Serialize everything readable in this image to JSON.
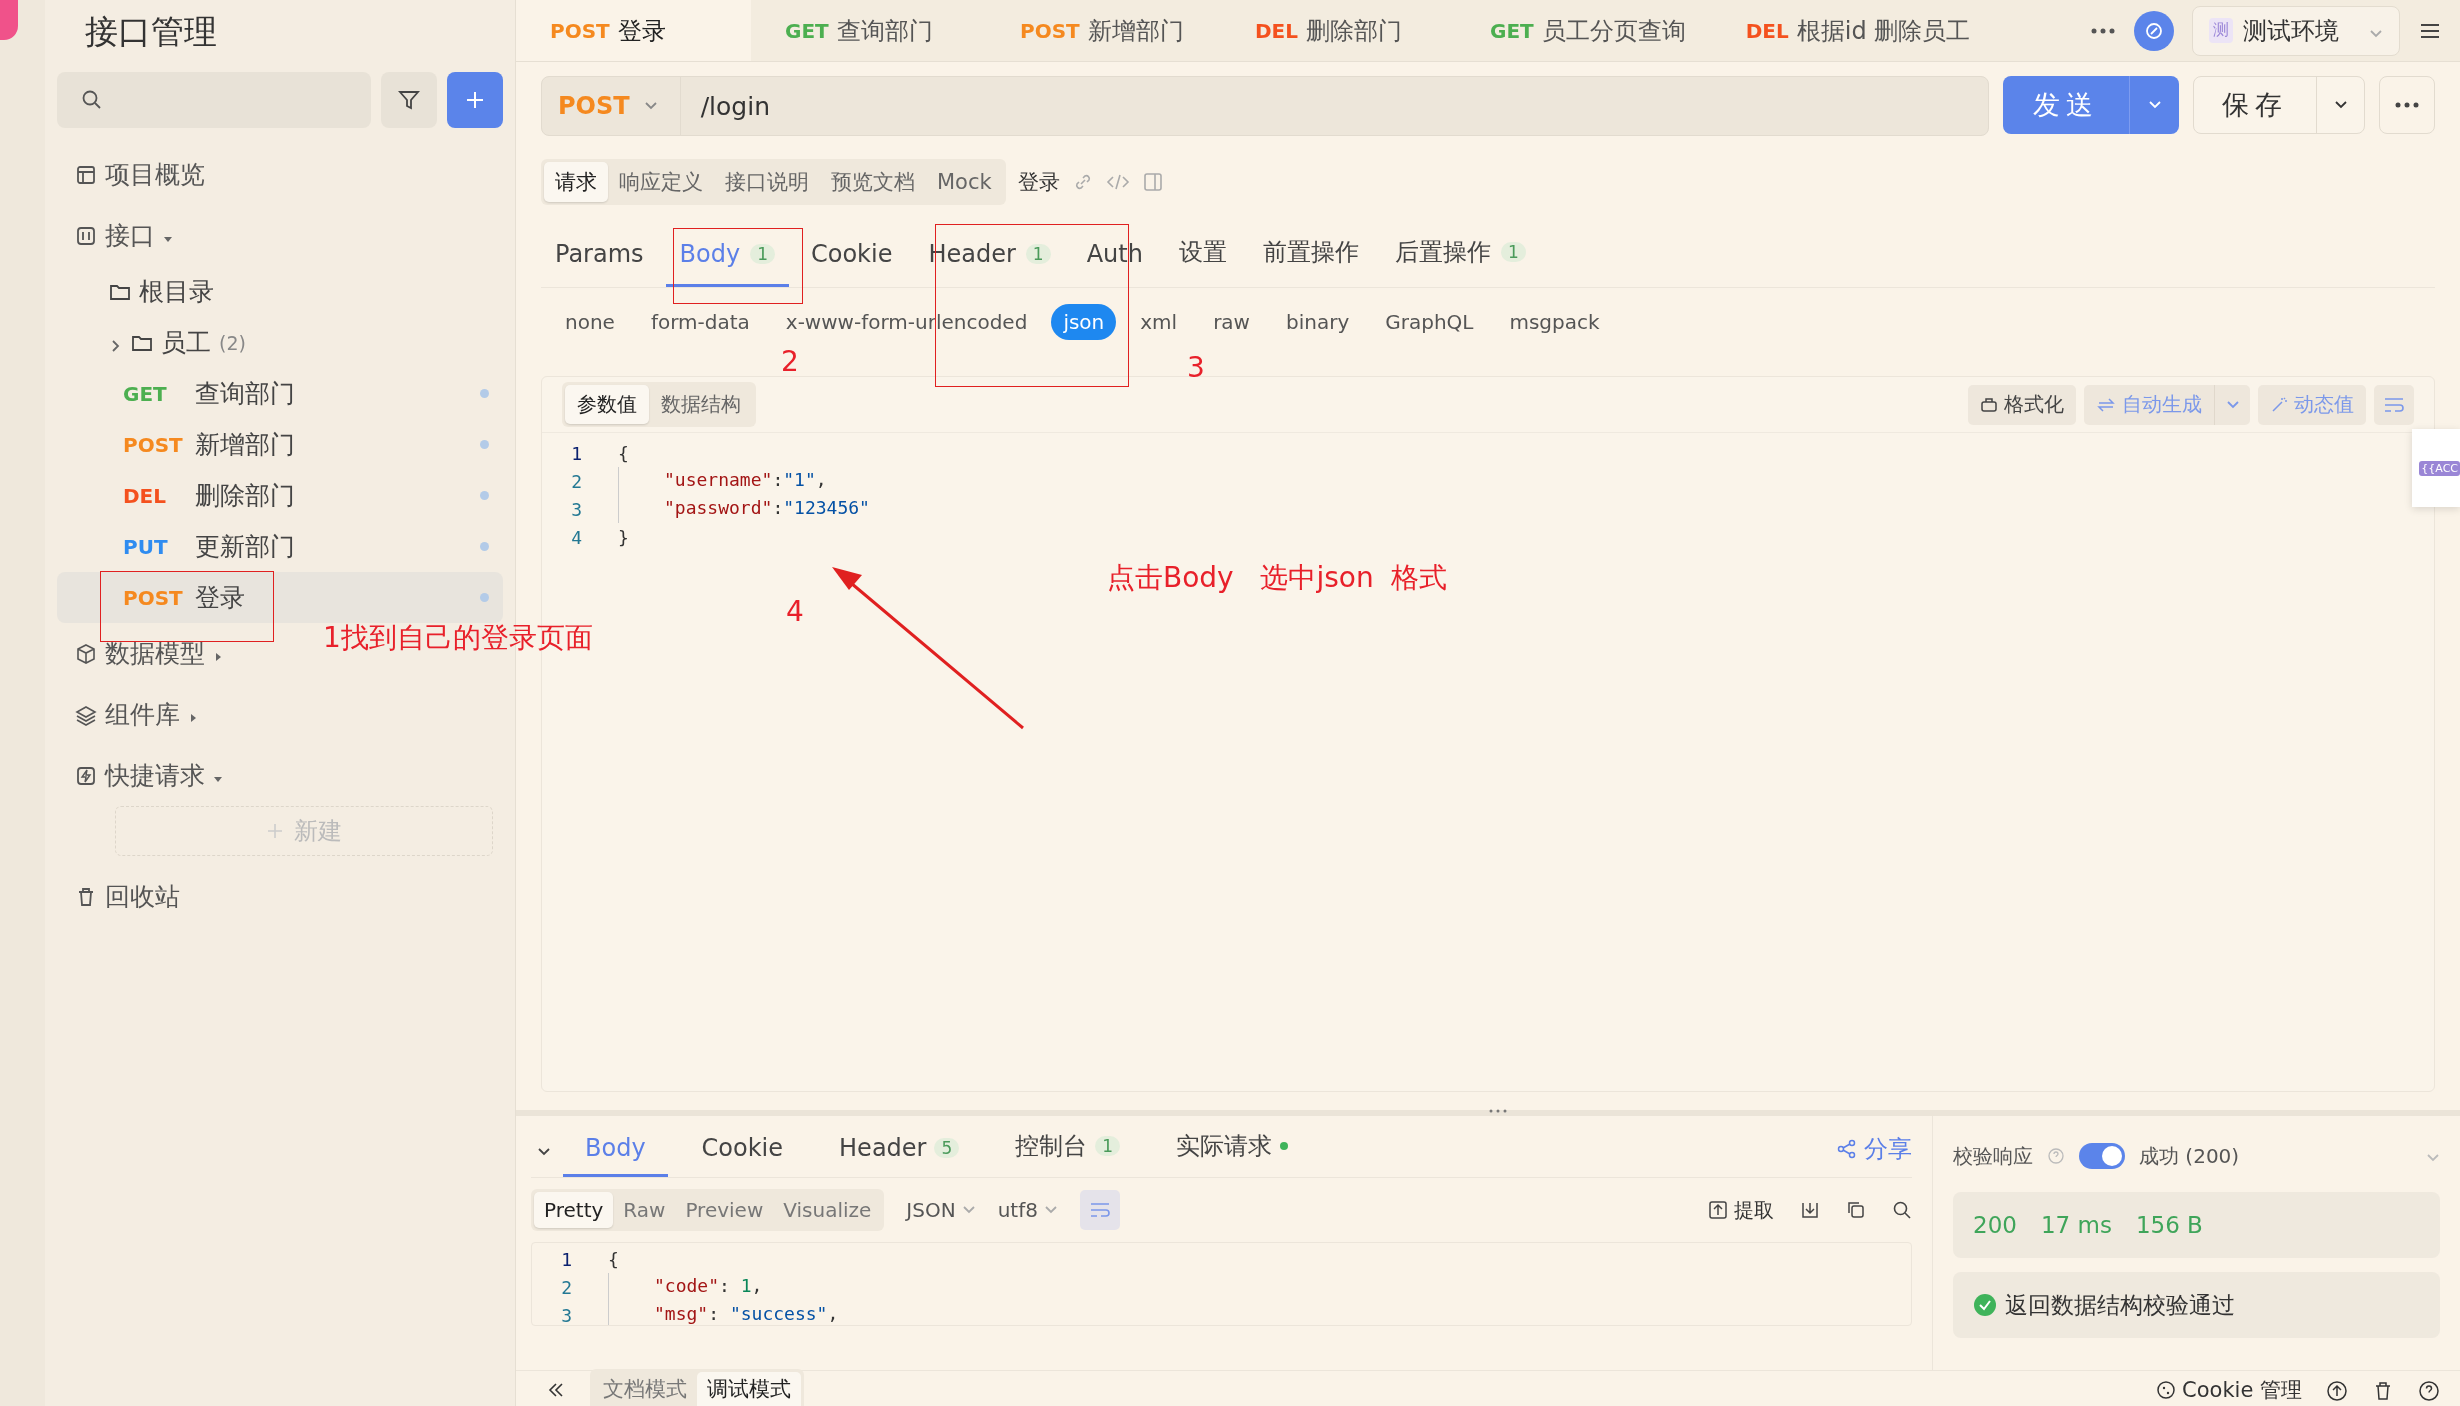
{
  "sidebar": {
    "title": "接口管理",
    "items": [
      {
        "kind": "link",
        "label": "项目概览"
      },
      {
        "kind": "group",
        "label": "接口",
        "expanded": true,
        "children": [
          {
            "kind": "folder",
            "label": "根目录",
            "children": [
              {
                "kind": "folder",
                "label": "员工",
                "count": "(2)",
                "expanded": false
              },
              {
                "kind": "endpoint",
                "method": "GET",
                "color": "#4caf50",
                "label": "查询部门",
                "selected": false
              },
              {
                "kind": "endpoint",
                "method": "POST",
                "color": "#f5891f",
                "label": "新增部门",
                "selected": false
              },
              {
                "kind": "endpoint",
                "method": "DEL",
                "color": "#f4511e",
                "label": "删除部门",
                "selected": false
              },
              {
                "kind": "endpoint",
                "method": "PUT",
                "color": "#2f8cf0",
                "label": "更新部门",
                "selected": false
              },
              {
                "kind": "endpoint",
                "method": "POST",
                "color": "#f5891f",
                "label": "登录",
                "selected": true
              }
            ]
          }
        ]
      },
      {
        "kind": "group",
        "label": "数据模型",
        "expanded": false
      },
      {
        "kind": "group",
        "label": "组件库",
        "expanded": false
      },
      {
        "kind": "group",
        "label": "快捷请求",
        "expanded": true,
        "children": [
          {
            "kind": "new",
            "label": "新建"
          }
        ]
      },
      {
        "kind": "link",
        "label": "回收站"
      }
    ]
  },
  "top_tabs": [
    {
      "method": "POST",
      "color": "#f5891f",
      "label": "登录",
      "selected": true
    },
    {
      "method": "GET",
      "color": "#4caf50",
      "label": "查询部门",
      "selected": false
    },
    {
      "method": "POST",
      "color": "#f5891f",
      "label": "新增部门",
      "selected": false
    },
    {
      "method": "DEL",
      "color": "#f4511e",
      "label": "删除部门",
      "selected": false
    },
    {
      "method": "GET",
      "color": "#4caf50",
      "label": "员工分页查询",
      "selected": false
    },
    {
      "method": "DEL",
      "color": "#f4511e",
      "label": "根据id 删除员工",
      "selected": false
    }
  ],
  "environment": {
    "badge": "测",
    "label": "测试环境"
  },
  "request": {
    "method": "POST",
    "url": "/login",
    "send": "发送",
    "save": "保存"
  },
  "sub_tabs": [
    {
      "label": "请求",
      "selected": true
    },
    {
      "label": "响应定义",
      "selected": false
    },
    {
      "label": "接口说明",
      "selected": false
    },
    {
      "label": "预览文档",
      "selected": false
    },
    {
      "label": "Mock",
      "selected": false
    }
  ],
  "endpoint_name": "登录",
  "param_tabs": [
    {
      "label": "Params",
      "selected": false
    },
    {
      "label": "Body",
      "count": "1",
      "selected": true
    },
    {
      "label": "Cookie",
      "selected": false
    },
    {
      "label": "Header",
      "count": "1",
      "selected": false
    },
    {
      "label": "Auth",
      "selected": false
    },
    {
      "label": "设置",
      "selected": false
    },
    {
      "label": "前置操作",
      "selected": false
    },
    {
      "label": "后置操作",
      "count": "1",
      "selected": false
    }
  ],
  "body_types": [
    {
      "label": "none",
      "selected": false
    },
    {
      "label": "form-data",
      "selected": false
    },
    {
      "label": "x-www-form-urlencoded",
      "selected": false
    },
    {
      "label": "json",
      "selected": true
    },
    {
      "label": "xml",
      "selected": false
    },
    {
      "label": "raw",
      "selected": false
    },
    {
      "label": "binary",
      "selected": false
    },
    {
      "label": "GraphQL",
      "selected": false
    },
    {
      "label": "msgpack",
      "selected": false
    }
  ],
  "editor": {
    "modes": [
      {
        "label": "参数值",
        "selected": true
      },
      {
        "label": "数据结构",
        "selected": false
      }
    ],
    "format": "格式化",
    "auto": "自动生成",
    "dynamic": "动态值",
    "lines": [
      {
        "no": "1",
        "tokens": [
          {
            "kind": "punct",
            "t": "{"
          }
        ]
      },
      {
        "no": "2",
        "tokens": [
          {
            "kind": "key",
            "t": "\"username\""
          },
          {
            "kind": "punct",
            "t": ":"
          },
          {
            "kind": "string",
            "t": "\"1\""
          },
          {
            "kind": "punct",
            "t": ","
          }
        ]
      },
      {
        "no": "3",
        "tokens": [
          {
            "kind": "key",
            "t": "\"password\""
          },
          {
            "kind": "punct",
            "t": ":"
          },
          {
            "kind": "string",
            "t": "\"123456\""
          }
        ]
      },
      {
        "no": "4",
        "tokens": [
          {
            "kind": "punct",
            "t": "}"
          }
        ]
      }
    ]
  },
  "popup": {
    "tag": "{{ACC"
  },
  "annotations": [
    "1找到自己的登录页面",
    "2",
    "3",
    "4",
    "点击Body   选中json  格式"
  ],
  "response": {
    "tabs": [
      {
        "label": "Body",
        "selected": true
      },
      {
        "label": "Cookie",
        "selected": false
      },
      {
        "label": "Header",
        "count": "5",
        "selected": false
      },
      {
        "label": "控制台",
        "count": "1",
        "selected": false
      },
      {
        "label": "实际请求",
        "dot": true,
        "selected": false
      }
    ],
    "share": "分享",
    "formats": [
      {
        "label": "Pretty",
        "selected": true
      },
      {
        "label": "Raw",
        "selected": false
      },
      {
        "label": "Preview",
        "selected": false
      },
      {
        "label": "Visualize",
        "selected": false
      }
    ],
    "language": "JSON",
    "encoding": "utf8",
    "extract": "提取",
    "lines": [
      {
        "no": "1",
        "tokens": [
          {
            "kind": "punct",
            "t": "{"
          }
        ]
      },
      {
        "no": "2",
        "tokens": [
          {
            "kind": "key",
            "t": "\"code\""
          },
          {
            "kind": "punct",
            "t": ": "
          },
          {
            "kind": "number",
            "t": "1"
          },
          {
            "kind": "punct",
            "t": ","
          }
        ]
      },
      {
        "no": "3",
        "tokens": [
          {
            "kind": "key",
            "t": "\"msg\""
          },
          {
            "kind": "punct",
            "t": ": "
          },
          {
            "kind": "string",
            "t": "\"success\""
          },
          {
            "kind": "punct",
            "t": ","
          }
        ]
      }
    ]
  },
  "validation": {
    "label": "校验响应",
    "on": true,
    "result": "成功 (200)",
    "status": "200",
    "time": "17 ms",
    "size": "156 B",
    "message": "返回数据结构校验通过"
  },
  "bottom_bar": {
    "modes": [
      {
        "label": "文档模式",
        "selected": false
      },
      {
        "label": "调试模式",
        "selected": true
      }
    ],
    "cookie": "Cookie 管理"
  }
}
